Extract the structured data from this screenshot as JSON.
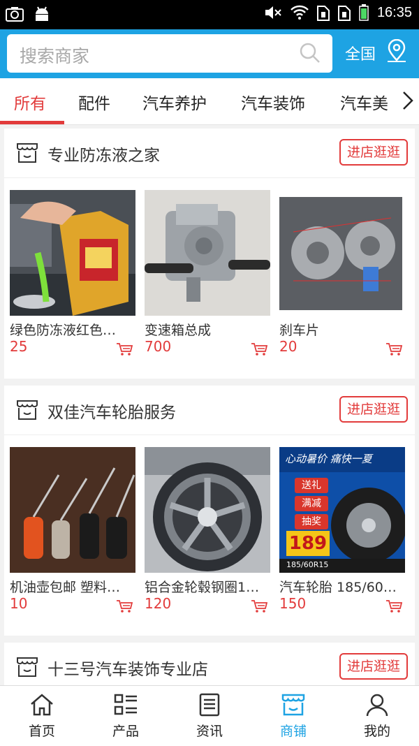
{
  "status_bar": {
    "time": "16:35"
  },
  "search": {
    "placeholder": "搜索商家",
    "region_label": "全国"
  },
  "tabs": [
    {
      "label": "所有"
    },
    {
      "label": "配件"
    },
    {
      "label": "汽车养护"
    },
    {
      "label": "汽车装饰"
    },
    {
      "label": "汽车美"
    }
  ],
  "shops": [
    {
      "name": "专业防冻液之家",
      "enter_label": "进店逛逛",
      "products": [
        {
          "name": "绿色防冻液红色…",
          "price": "25"
        },
        {
          "name": "变速箱总成",
          "price": "700"
        },
        {
          "name": "刹车片",
          "price": "20"
        }
      ]
    },
    {
      "name": "双佳汽车轮胎服务",
      "enter_label": "进店逛逛",
      "products": [
        {
          "name": "机油壶包邮 塑料…",
          "price": "10"
        },
        {
          "name": "铝合金轮毂钢圈1…",
          "price": "120"
        },
        {
          "name": "汽车轮胎 185/60…",
          "price": "150"
        }
      ]
    },
    {
      "name": "十三号汽车装饰专业店",
      "enter_label": "进店逛逛"
    }
  ],
  "tire_banner": {
    "headline": "心动暑价 痛快一夏",
    "tags": [
      "送礼",
      "满减",
      "抽奖"
    ],
    "price": "189",
    "size": "185/60R15"
  },
  "bottom_nav": [
    {
      "label": "首页",
      "icon": "home-icon"
    },
    {
      "label": "产品",
      "icon": "product-list-icon"
    },
    {
      "label": "资讯",
      "icon": "news-icon"
    },
    {
      "label": "商铺",
      "icon": "shop-icon"
    },
    {
      "label": "我的",
      "icon": "user-icon"
    }
  ],
  "colors": {
    "primary": "#1ea3e3",
    "accent": "#e23b3b"
  }
}
